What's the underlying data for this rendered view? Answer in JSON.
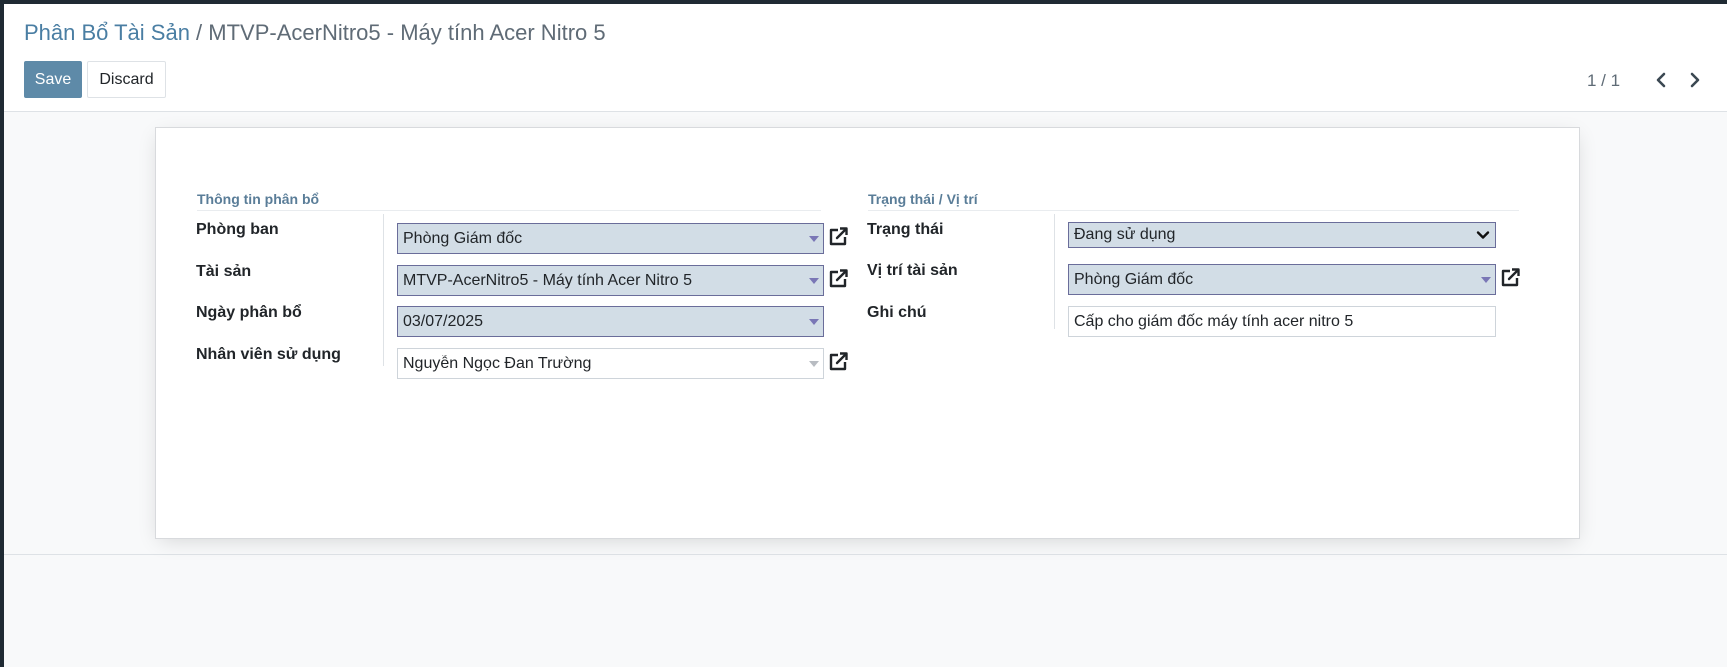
{
  "breadcrumb": {
    "parent": "Phân Bổ Tài Sản",
    "separator": " / ",
    "current": "MTVP-AcerNitro5 - Máy tính Acer Nitro 5"
  },
  "toolbar": {
    "save_label": "Save",
    "discard_label": "Discard"
  },
  "pager": {
    "value": "1 / 1",
    "prev_icon": "chevron-left-icon",
    "next_icon": "chevron-right-icon"
  },
  "form": {
    "group_left_title": "Thông tin phân bổ",
    "group_right_title": "Trạng thái / Vị trí",
    "fields": {
      "phong_ban": {
        "label": "Phòng ban",
        "value": "Phòng Giám đốc"
      },
      "tai_san": {
        "label": "Tài sản",
        "value": "MTVP-AcerNitro5 - Máy tính Acer Nitro 5"
      },
      "ngay_phan_bo": {
        "label": "Ngày phân bổ",
        "value": "03/07/2025"
      },
      "nhan_vien": {
        "label": "Nhân viên sử dụng",
        "value": "Nguyễn Ngọc Đan Trường"
      },
      "trang_thai": {
        "label": "Trạng thái",
        "value": "Đang sử dụng"
      },
      "vi_tri": {
        "label": "Vị trí tài sản",
        "value": "Phòng Giám đốc"
      },
      "ghi_chu": {
        "label": "Ghi chú",
        "value": "Cấp cho giám đốc máy tính acer nitro 5"
      }
    }
  },
  "colors": {
    "accent": "#5e8aa8",
    "required_field_bg": "#d2dde6",
    "field_border": "#6a6d9a",
    "group_title": "#5a7d98"
  }
}
